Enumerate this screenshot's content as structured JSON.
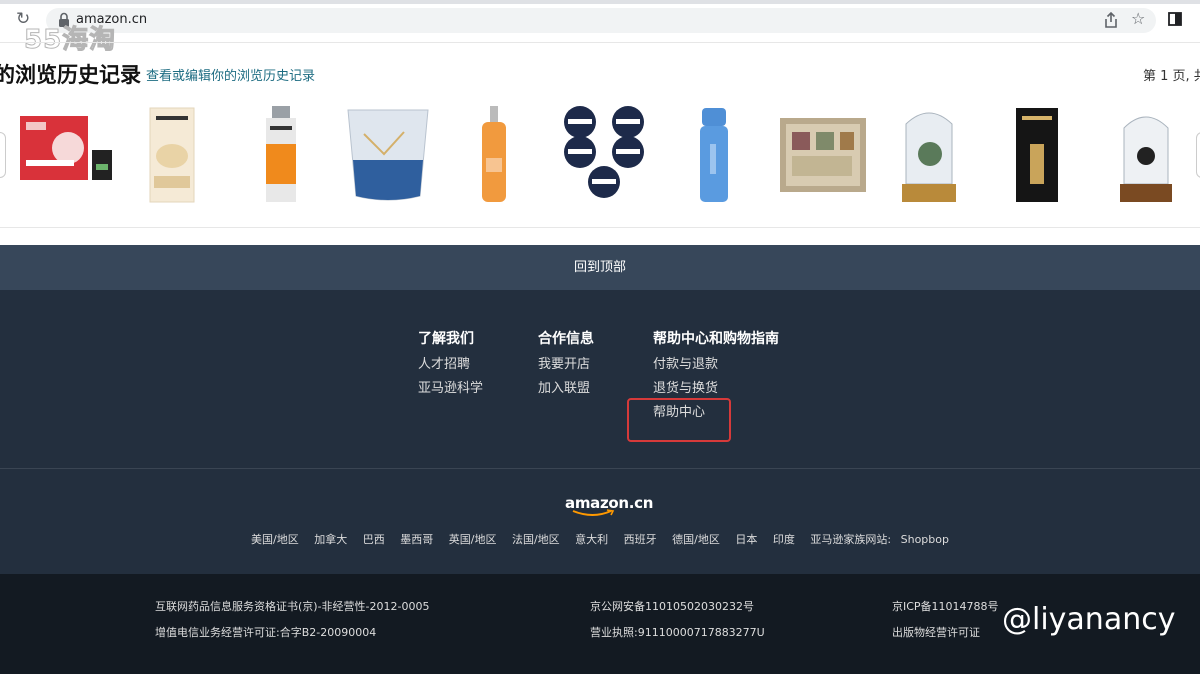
{
  "browser": {
    "url": "amazon.cn"
  },
  "watermark_top": "55海淘",
  "history": {
    "title": "的浏览历史记录",
    "edit_link": "查看或编辑你的浏览历史记录",
    "page_indicator": "第 1 页, 共",
    "products": [
      "face-mask-product",
      "loreal-cream-product",
      "loreal-men-serum-product",
      "glass-cup-product",
      "body-wash-product",
      "nivea-men-cream-product",
      "blue-thermos-product",
      "soap-gift-box-product",
      "totoro-music-box-product",
      "loreal-black-serum-product",
      "kiki-figure-product"
    ]
  },
  "back_to_top": "回到顶部",
  "footer": {
    "columns": [
      {
        "heading": "了解我们",
        "items": [
          "人才招聘",
          "亚马逊科学"
        ]
      },
      {
        "heading": "合作信息",
        "items": [
          "我要开店",
          "加入联盟"
        ]
      },
      {
        "heading": "帮助中心和购物指南",
        "items": [
          "付款与退款",
          "退货与换货",
          "帮助中心"
        ]
      }
    ],
    "logo": "amazon.cn",
    "regions": [
      "美国/地区",
      "加拿大",
      "巴西",
      "墨西哥",
      "英国/地区",
      "法国/地区",
      "意大利",
      "西班牙",
      "德国/地区",
      "日本",
      "印度",
      "亚马逊家族网站:",
      "Shopbop"
    ],
    "legal": {
      "left": [
        "互联网药品信息服务资格证书(京)-非经营性-2012-0005",
        "增值电信业务经营许可证:合字B2-20090004"
      ],
      "middle": [
        "京公网安备11010502030232号",
        "营业执照:91110000717883277U"
      ],
      "right": [
        "京ICP备11014788号",
        "出版物经营许可证"
      ]
    }
  },
  "watermark_bottom": "@liyanancy",
  "colors": {
    "back_to_top_bg": "#37475a",
    "footer_bg": "#232f3e",
    "legal_bg": "#131a22",
    "highlight": "#d63a3a",
    "link": "#1d6c82"
  }
}
